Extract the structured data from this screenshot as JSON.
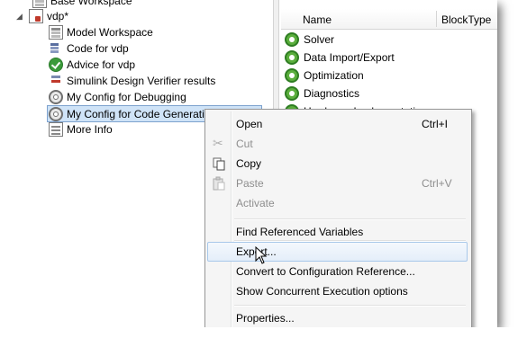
{
  "tree": {
    "partial_top": "Base Workspace",
    "model": "vdp*",
    "children": [
      "Model Workspace",
      "Code for vdp",
      "Advice for vdp",
      "Simulink Design Verifier results",
      "My Config for Debugging",
      "My Config for Code Generation (Active)",
      "More Info"
    ]
  },
  "contents": {
    "columns": [
      "Name",
      "BlockType"
    ],
    "rows": [
      "Solver",
      "Data Import/Export",
      "Optimization",
      "Diagnostics",
      "Hardware Implementation"
    ]
  },
  "context_menu": {
    "items": [
      {
        "label": "Open",
        "shortcut": "Ctrl+I",
        "enabled": true
      },
      {
        "label": "Cut",
        "shortcut": "",
        "enabled": false
      },
      {
        "label": "Copy",
        "shortcut": "",
        "enabled": true
      },
      {
        "label": "Paste",
        "shortcut": "Ctrl+V",
        "enabled": false
      },
      {
        "label": "Activate",
        "shortcut": "",
        "enabled": false
      },
      {
        "label": "Find Referenced Variables",
        "shortcut": "",
        "enabled": true
      },
      {
        "label": "Export...",
        "shortcut": "",
        "enabled": true,
        "hovered": true
      },
      {
        "label": "Convert to Configuration Reference...",
        "shortcut": "",
        "enabled": true
      },
      {
        "label": "Show Concurrent Execution options",
        "shortcut": "",
        "enabled": true
      },
      {
        "label": "Properties...",
        "shortcut": "",
        "enabled": true
      }
    ]
  },
  "colors": {
    "selection": "#cfe3f7",
    "menu_hover_border": "#a8c8ea",
    "gear_green": "#5aae3c"
  }
}
